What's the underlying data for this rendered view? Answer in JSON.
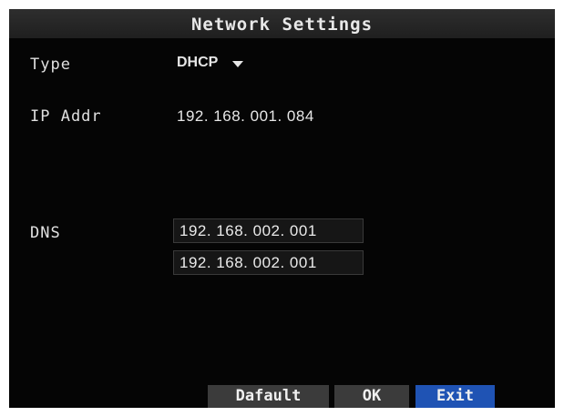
{
  "dialog": {
    "title": "Network Settings"
  },
  "fields": {
    "type_label": "Type",
    "type_value": "DHCP",
    "ip_label": "IP Addr",
    "ip_value": "192. 168. 001. 084",
    "dns_label": "DNS",
    "dns_primary": "192. 168. 002. 001",
    "dns_secondary": "192. 168. 002. 001"
  },
  "buttons": {
    "default_label": "Dafault",
    "ok_label": "OK",
    "exit_label": "Exit"
  },
  "colors": {
    "background": "#050505",
    "selected_button": "#1f53b4",
    "button": "#3b3b3b"
  },
  "icons": {
    "type_dropdown": "chevron-down-icon"
  }
}
